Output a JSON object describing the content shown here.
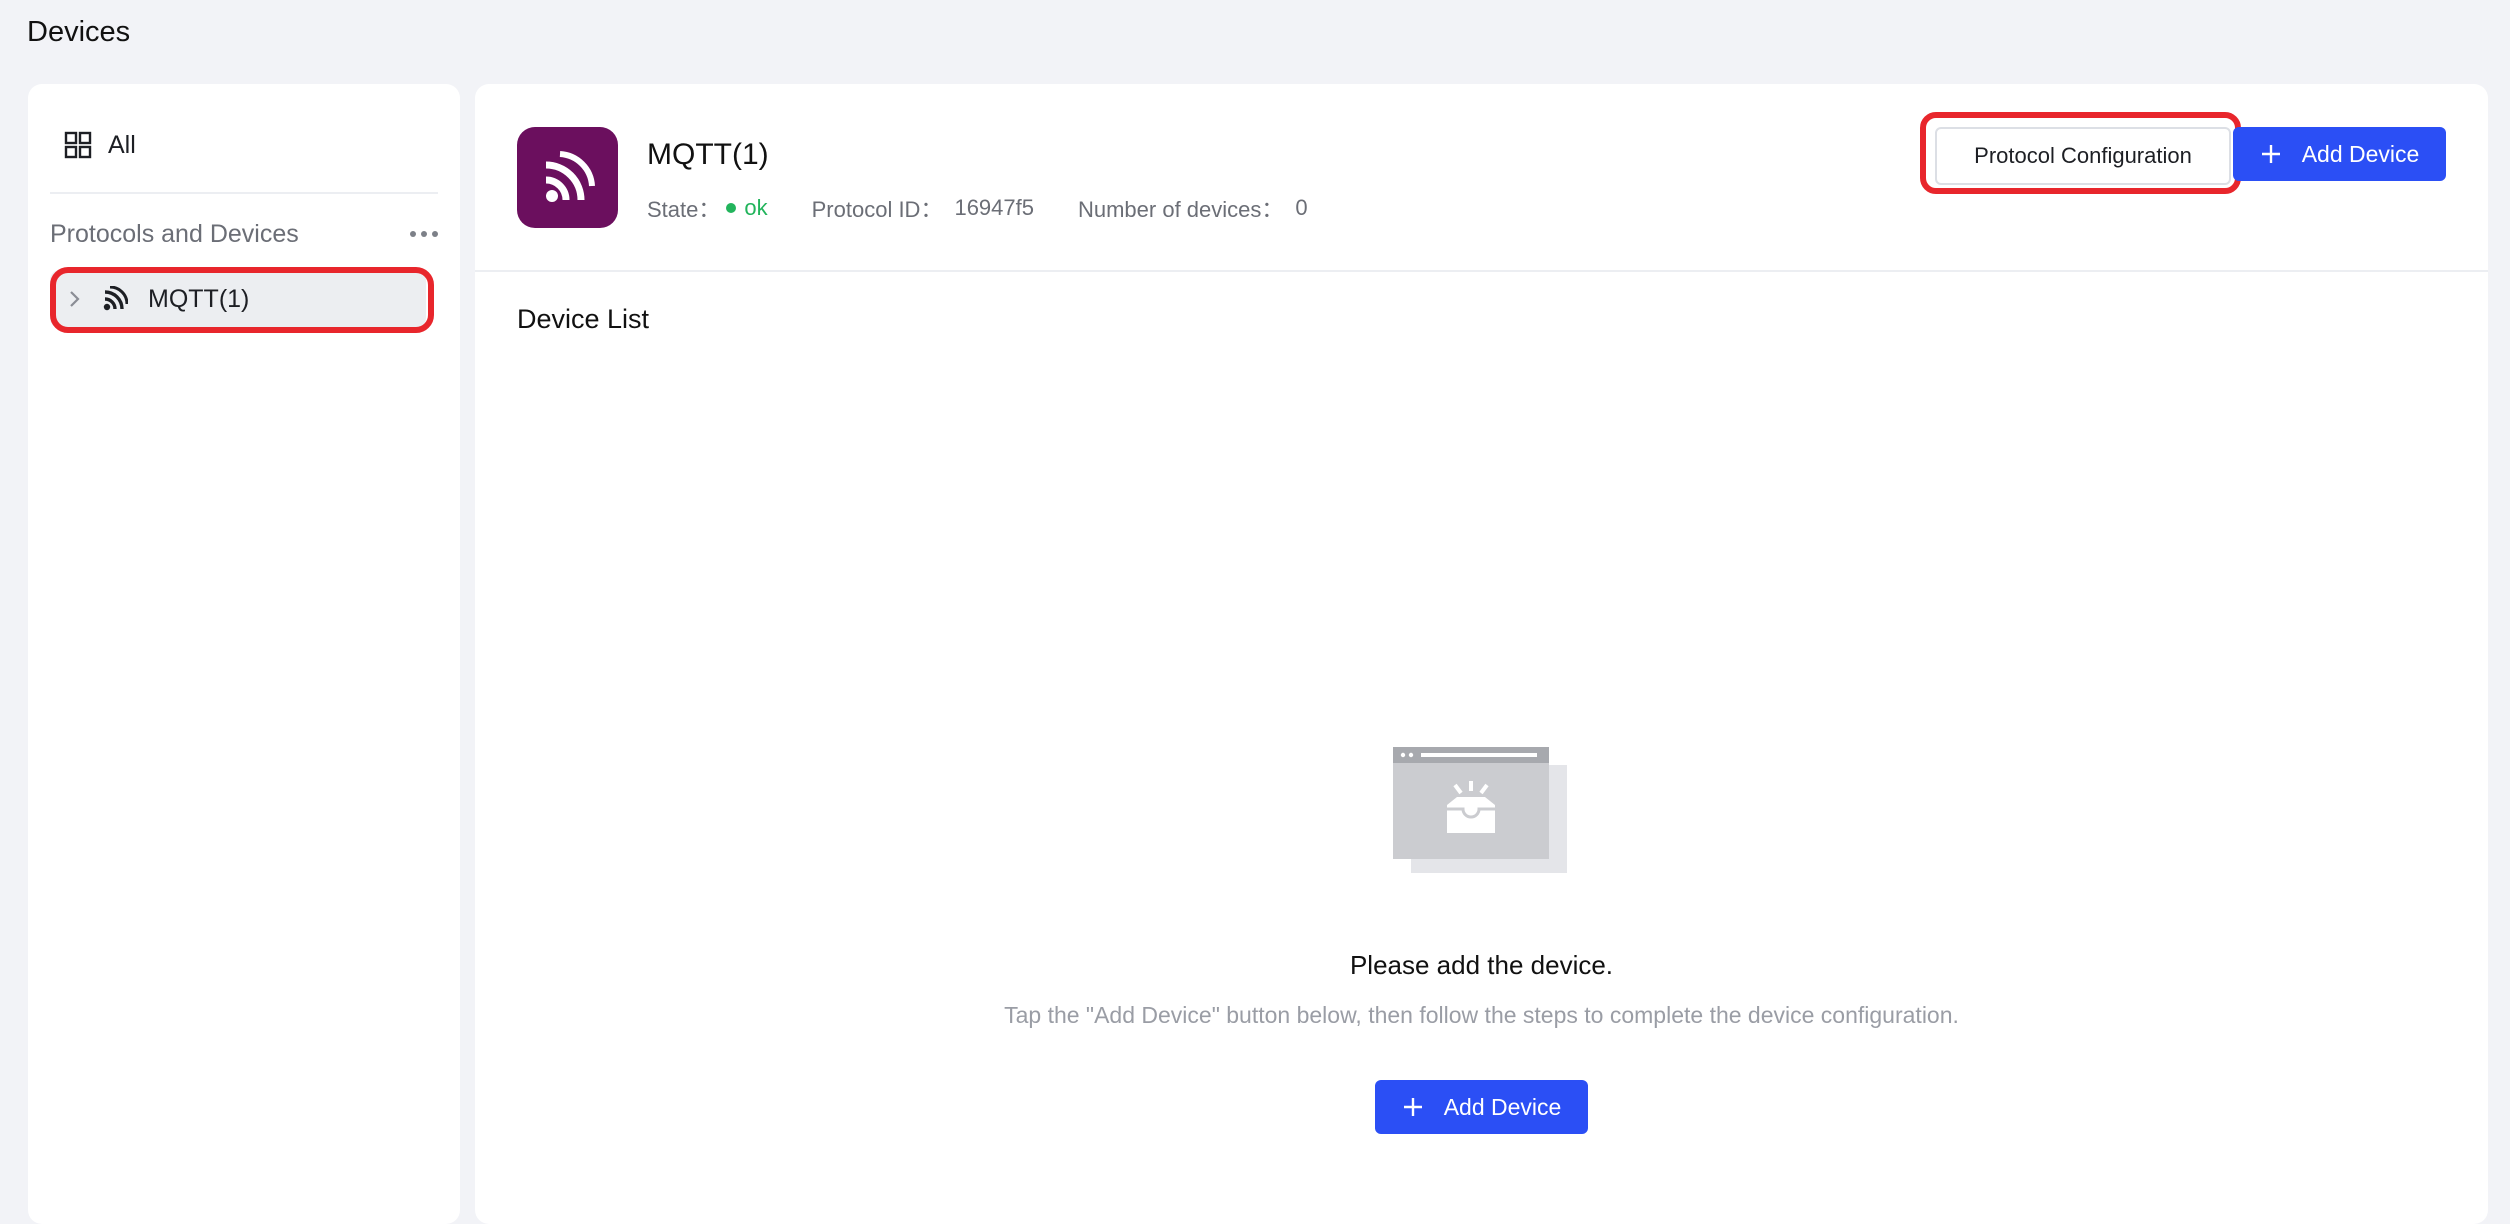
{
  "page": {
    "title": "Devices"
  },
  "sidebar": {
    "all_label": "All",
    "section_label": "Protocols and Devices",
    "tree": [
      {
        "label": "MQTT(1)",
        "selected": true,
        "highlighted": true
      }
    ]
  },
  "protocol": {
    "name": "MQTT(1)",
    "avatar_color": "#6b0f5e",
    "state_label": "State：",
    "state_value": "ok",
    "state_color": "#22b45c",
    "id_label": "Protocol ID：",
    "id_value": "16947f5",
    "count_label": "Number of devices：",
    "count_value": "0"
  },
  "toolbar": {
    "protocol_config_label": "Protocol Configuration",
    "add_device_label": "Add Device"
  },
  "device_list": {
    "title": "Device List",
    "empty_title": "Please add the device.",
    "empty_description": "Tap the \"Add Device\" button below, then follow the steps to complete the device configuration.",
    "add_button_label": "Add Device"
  },
  "colors": {
    "primary": "#2b4ff5",
    "highlight": "#e8262c",
    "background": "#f2f3f7"
  }
}
